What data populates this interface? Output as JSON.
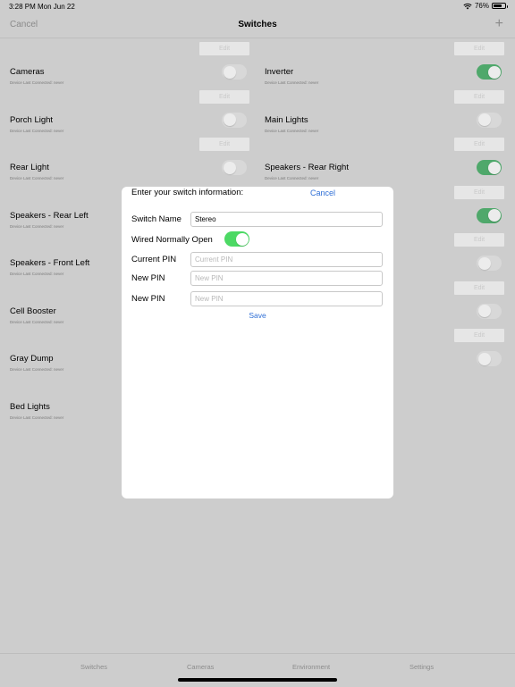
{
  "status": {
    "time": "3:28 PM",
    "date": "Mon Jun 22",
    "battery": "76%",
    "battery_level": 0.76
  },
  "nav": {
    "cancel": "Cancel",
    "title": "Switches",
    "add": "+"
  },
  "switches_left": [
    {
      "name": "Cameras",
      "sub": "Device Last Connected: never",
      "edit": "Edit",
      "on": false,
      "show_edit": true,
      "show_toggle": true
    },
    {
      "name": "Porch Light",
      "sub": "Device Last Connected: never",
      "edit": "Edit",
      "on": false,
      "show_edit": true,
      "show_toggle": true
    },
    {
      "name": "Rear Light",
      "sub": "Device Last Connected: never",
      "edit": "Edit",
      "on": false,
      "show_edit": true,
      "show_toggle": true
    },
    {
      "name": "Speakers - Rear Left",
      "sub": "Device Last Connected: never",
      "edit": "",
      "on": false,
      "show_edit": false,
      "show_toggle": false
    },
    {
      "name": "Speakers - Front Left",
      "sub": "Device Last Connected: never",
      "edit": "",
      "on": false,
      "show_edit": false,
      "show_toggle": false
    },
    {
      "name": "Cell Booster",
      "sub": "Device Last Connected: never",
      "edit": "",
      "on": false,
      "show_edit": false,
      "show_toggle": false
    },
    {
      "name": "Gray Dump",
      "sub": "Device Last Connected: never",
      "edit": "",
      "on": false,
      "show_edit": false,
      "show_toggle": false
    },
    {
      "name": "Bed Lights",
      "sub": "Device Last Connected: never",
      "edit": "",
      "on": false,
      "show_edit": false,
      "show_toggle": false
    }
  ],
  "switches_right": [
    {
      "name": "Inverter",
      "sub": "Device Last Connected: never",
      "edit": "Edit",
      "on": true,
      "show_edit": true,
      "show_toggle": true
    },
    {
      "name": "Main Lights",
      "sub": "Device Last Connected: never",
      "edit": "Edit",
      "on": false,
      "show_edit": true,
      "show_toggle": true
    },
    {
      "name": "Speakers - Rear Right",
      "sub": "Device Last Connected: never",
      "edit": "Edit",
      "on": true,
      "show_edit": true,
      "show_toggle": true
    },
    {
      "name": "",
      "sub": "",
      "edit": "Edit",
      "on": true,
      "show_edit": true,
      "show_toggle": true
    },
    {
      "name": "",
      "sub": "",
      "edit": "Edit",
      "on": false,
      "show_edit": true,
      "show_toggle": true
    },
    {
      "name": "",
      "sub": "",
      "edit": "Edit",
      "on": false,
      "show_edit": true,
      "show_toggle": true
    },
    {
      "name": "",
      "sub": "",
      "edit": "Edit",
      "on": false,
      "show_edit": true,
      "show_toggle": true
    }
  ],
  "modal": {
    "heading": "Enter your switch information:",
    "cancel": "Cancel",
    "switch_name_label": "Switch Name",
    "switch_name_value": "Stereo",
    "wired_label": "Wired Normally Open",
    "wired_on": true,
    "current_pin_label": "Current PIN",
    "current_pin_placeholder": "Current PIN",
    "new_pin_label": "New PIN",
    "new_pin_placeholder": "New PIN",
    "new_pin2_label": "New PIN",
    "new_pin2_placeholder": "New PIN",
    "save": "Save"
  },
  "tabs": [
    "Switches",
    "Cameras",
    "Environment",
    "Settings"
  ],
  "colors": {
    "accent_blue": "#2f6fd6",
    "toggle_on": "#4cd964",
    "dim_overlay_bg": "#cdcdcd"
  }
}
